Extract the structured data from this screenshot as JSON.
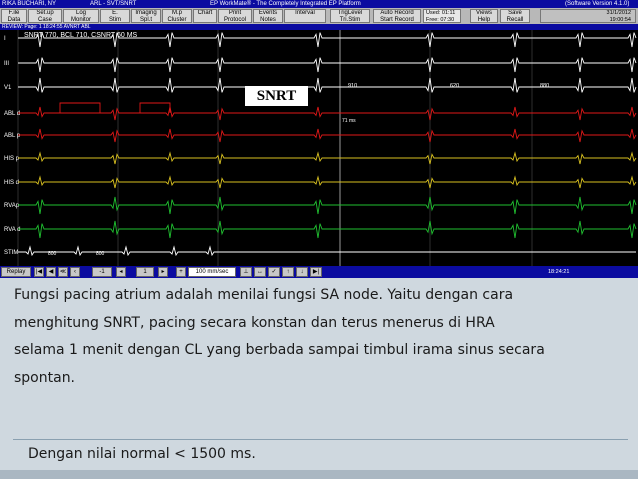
{
  "app": {
    "patient": "RIKA BUCHARI, NY",
    "procedure": "ARL - SVT/SNRT",
    "title": "EP WorkMate® - The Completely Integrated EP Platform",
    "version": "(Software Version 4.1.0)"
  },
  "toolbar": {
    "buttons": [
      {
        "top": "F.ile",
        "bottom": "Data"
      },
      {
        "top": "Set.up",
        "bottom": "Case"
      },
      {
        "top": "Log",
        "bottom": "Monitor"
      },
      {
        "top": "E.",
        "bottom": "Stim"
      },
      {
        "top": "Imaging",
        "bottom": "Spl.t"
      },
      {
        "top": "M.p",
        "bottom": "Cluster"
      },
      {
        "top": "",
        "bottom": "Chart"
      },
      {
        "top": "Print",
        "bottom": "Protocol"
      },
      {
        "top": "Events",
        "bottom": "Notes"
      },
      {
        "top": "Interval",
        "bottom": ""
      },
      {
        "top": "TrigLevel",
        "bottom": "Tri.Stim"
      },
      {
        "top": "Auto Record",
        "bottom": "Start Record"
      },
      {
        "top": "Views",
        "bottom": "Help"
      },
      {
        "top": "Save",
        "bottom": "Recall"
      }
    ],
    "used_label": "Used: 01:11",
    "free_label": "Free: 07:30",
    "date": "31/1/2012",
    "time": "19:00:54"
  },
  "review": {
    "label": "REVIEW: Page: 1  18:24:55  AVNRT ABL"
  },
  "ecg": {
    "header": "SNRT 770, BCL 710, CSNRT 60 MS",
    "channels": [
      "I",
      "III",
      "V1",
      "ABL d",
      "ABL p",
      "HIS p",
      "HIS d",
      "RVAp",
      "RVA d",
      "STIM"
    ],
    "interval_labels": [
      "910",
      "620",
      "880"
    ],
    "ms_label": "71 ms",
    "stim_labels": [
      "800",
      "800"
    ],
    "overlay_label": "SNRT"
  },
  "bottombar": {
    "replay": "Replay",
    "speed": "100 mm/sec",
    "time": "18:24:21"
  },
  "slide": {
    "lines": [
      "Fungsi pacing atrium adalah menilai fungsi SA node. Yaitu dengan cara",
      "menghitung SNRT, pacing secara konstan dan terus menerus  di HRA",
      "selama 1 menit dengan CL yang berbada sampai timbul irama sinus secara",
      "spontan."
    ],
    "normal_value": "Dengan nilai normal < 1500  ms."
  },
  "colors": {
    "title_bar": "#0b0ba0",
    "ecg_background": "#000000",
    "lead_white": "#ffffff",
    "abl_red": "#e01818",
    "his_yellow": "#d8c020",
    "rva_green": "#20c030",
    "slide_background": "#cfd8df"
  }
}
